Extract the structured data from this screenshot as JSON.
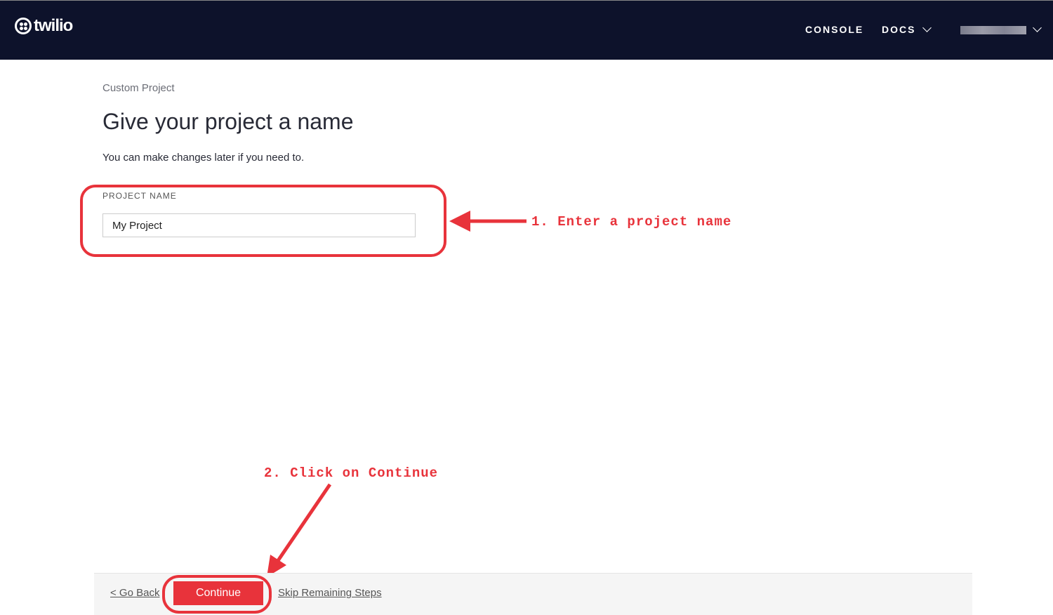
{
  "header": {
    "logo": "twilio",
    "nav": [
      "CONSOLE",
      "DOCS"
    ],
    "user_redacted": true
  },
  "page": {
    "breadcrumb": "Custom Project",
    "title": "Give your project a name",
    "subtitle": "You can make changes later if you need to.",
    "field_label": "PROJECT NAME",
    "field_value": "My Project"
  },
  "annotations": {
    "step1": "1. Enter a project name",
    "step2": "2. Click on Continue",
    "color": "#e8333b"
  },
  "footer": {
    "go_back": "< Go Back",
    "continue": "Continue",
    "skip": "Skip Remaining Steps"
  }
}
